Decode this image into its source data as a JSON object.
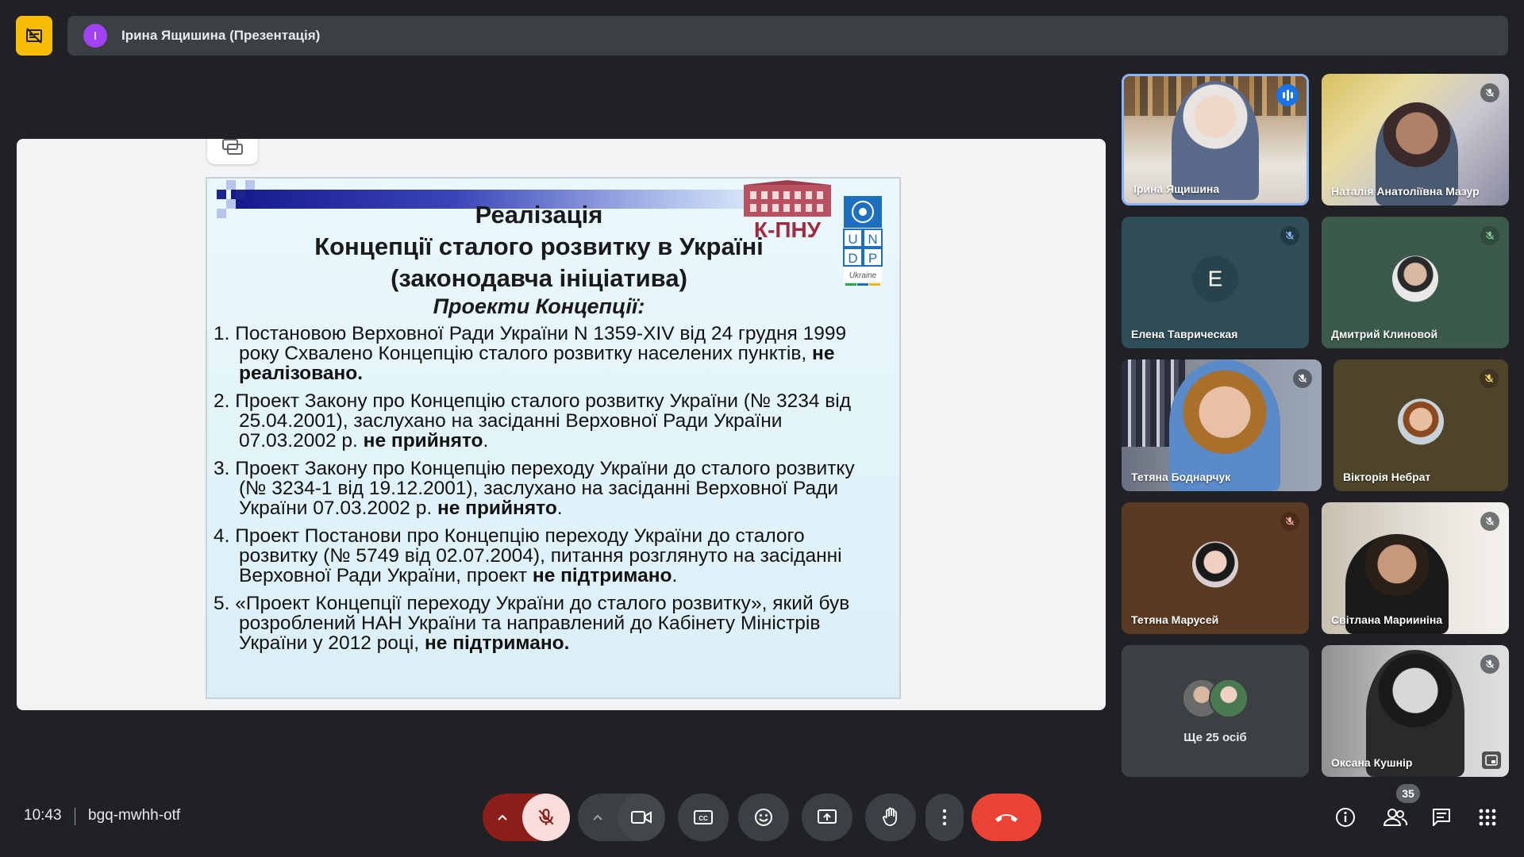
{
  "top_bar": {
    "presenter_initial": "І",
    "presenter_label": "Ірина Ящишина (Презентація)"
  },
  "slide": {
    "title_line1": "Реалізація",
    "title_line2": "Концепції сталого розвитку в Україні",
    "title_line3": "(законодавча ініціатива)",
    "subtitle": "Проекти Концепції:",
    "logo_kpnu": "К-ПНУ",
    "logo_undp": [
      "U",
      "N",
      "D",
      "P"
    ],
    "logo_undp_country": "Ukraine",
    "items": [
      {
        "text": "1. Постановою Верховної Ради України N 1359-XIV від 24 грудня 1999 року Схвалено Концепцію  сталого  розвитку  населених пунктів,",
        "bold": "не реалізовано.",
        "tail": ""
      },
      {
        "text": "2. Проект Закону про Концепцію сталого розвитку України (№ 3234 від 25.04.2001), заслухано на засіданні Верховної Ради України 07.03.2002 р.",
        "bold": "не прийнято",
        "tail": "."
      },
      {
        "text": "3. Проект Закону про Концепцію переходу України до сталого розвитку (№ 3234-1 від 19.12.2001), заслухано на засіданні Верховної Ради України 07.03.2002 р.",
        "bold": "не прийнято",
        "tail": "."
      },
      {
        "text": "4. Проект Постанови про Концепцію переходу України до сталого розвитку (№ 5749 від 02.07.2004), питання розглянуто на засіданні Верховної Ради України, проект",
        "bold": "не підтримано",
        "tail": "."
      },
      {
        "text": "5. «Проект Концепції переходу України до сталого розвитку», який був розроблений НАН України та направлений до Кабінету Міністрів України у 2012 році,",
        "bold": "не підтримано.",
        "tail": ""
      }
    ]
  },
  "participants": [
    {
      "name": "Ірина Ящишина",
      "state": "speaking"
    },
    {
      "name": "Наталія Анатоліївна Мазур",
      "state": "muted"
    },
    {
      "name": "Елена Тавричеcкая",
      "initial": "Е",
      "state": "muted"
    },
    {
      "name": "Дмитрий Клиновой",
      "state": "muted"
    },
    {
      "name": "Тетяна Боднарчук",
      "state": "muted"
    },
    {
      "name": "Вікторія Небрат",
      "state": "muted"
    },
    {
      "name": "Тетяна Марусей",
      "state": "muted"
    },
    {
      "name": "Світлана Марииніна",
      "state": "muted"
    },
    {
      "name": "Оксана Кушнір",
      "state": "muted"
    }
  ],
  "more_tile": {
    "label": "Ще 25 осіб"
  },
  "bottom_bar": {
    "time": "10:43",
    "meeting_code": "bgq-mwhh-otf",
    "participant_count": "35"
  },
  "colors": {
    "background": "#202124",
    "surface": "#3c4043",
    "record_badge": "#fbbc04",
    "hangup_red": "#ea4335",
    "speaking_blue": "#1a73e8",
    "mic_off_active": "#f9dedc"
  },
  "icons": {
    "record": "recording-off-icon",
    "mic": "mic-off-icon",
    "camera": "videocam-icon",
    "captions": "closed-captions-icon",
    "emoji": "emoji-icon",
    "present": "present-screen-icon",
    "hand": "raise-hand-icon",
    "more": "more-vert-icon",
    "hangup": "call-end-icon",
    "info": "info-icon",
    "people": "people-icon",
    "chat": "chat-icon",
    "activities": "apps-grid-icon"
  }
}
